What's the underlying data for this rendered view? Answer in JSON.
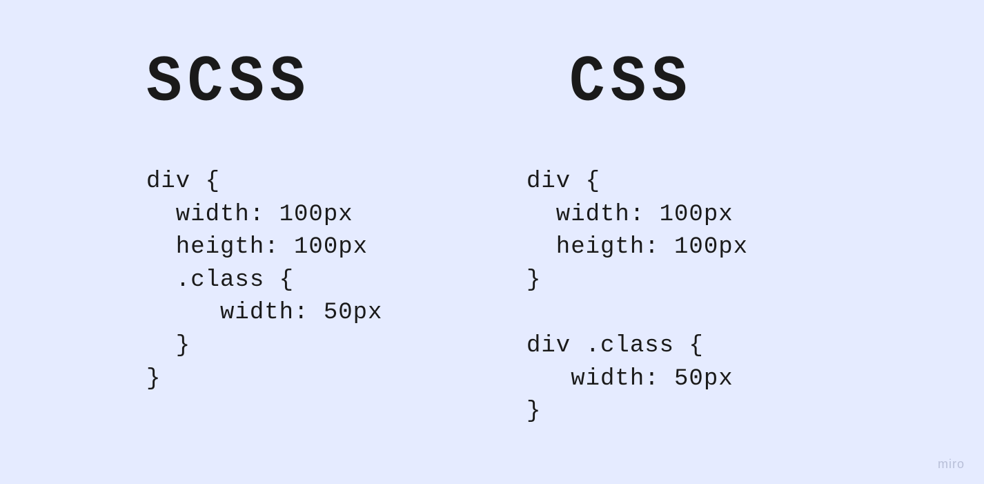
{
  "left": {
    "title": "SCSS",
    "code": "div {\n  width: 100px\n  heigth: 100px\n  .class {\n     width: 50px\n  }\n}"
  },
  "right": {
    "title": "CSS",
    "code": "div {\n  width: 100px\n  heigth: 100px\n}\n\ndiv .class {\n   width: 50px\n}"
  },
  "watermark": "miro"
}
